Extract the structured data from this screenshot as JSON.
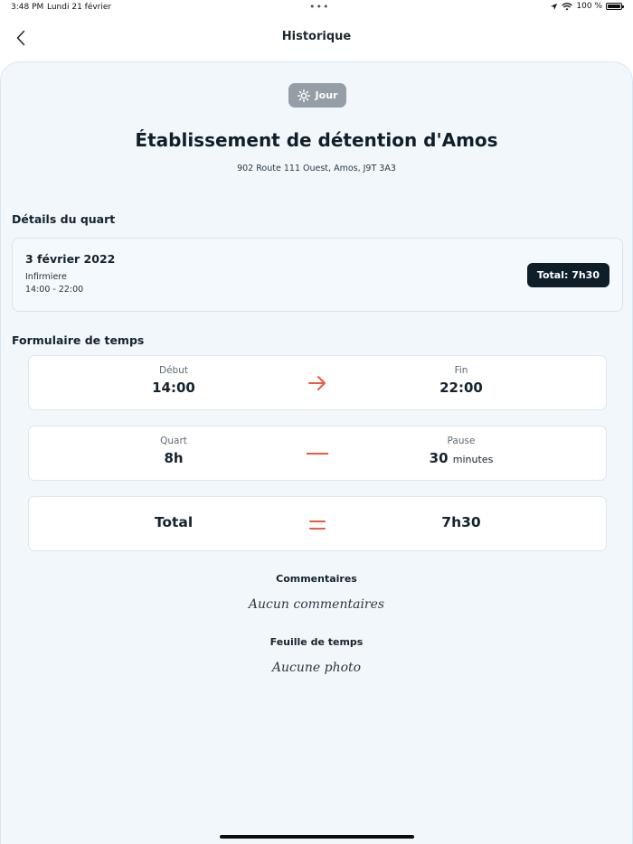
{
  "status_bar": {
    "time": "3:48 PM",
    "date": "Lundi 21 février",
    "dots": "•••",
    "battery": "100 %"
  },
  "nav": {
    "title": "Historique"
  },
  "shift": {
    "type_label": "Jour",
    "facility_name": "Établissement de détention d'Amos",
    "address": "902 Route 111 Ouest, Amos, J9T 3A3"
  },
  "details": {
    "section_title": "Détails du quart",
    "date": "3 février 2022",
    "role": "Infirmiere",
    "hours": "14:00 - 22:00",
    "total_badge": "Total: 7h30"
  },
  "timesheet": {
    "section_title": "Formulaire de temps",
    "start_label": "Début",
    "start_value": "14:00",
    "end_label": "Fin",
    "end_value": "22:00",
    "shift_label": "Quart",
    "shift_value": "8h",
    "break_label": "Pause",
    "break_value": "30",
    "break_unit": "minutes",
    "total_label": "Total",
    "total_value": "7h30"
  },
  "comments": {
    "title": "Commentaires",
    "value": "Aucun commentaires"
  },
  "sheet": {
    "title": "Feuille de temps",
    "value": "Aucune photo"
  },
  "colors": {
    "accent": "#e85a43",
    "dark": "#0f1f2a",
    "background": "#f2f7fc"
  }
}
